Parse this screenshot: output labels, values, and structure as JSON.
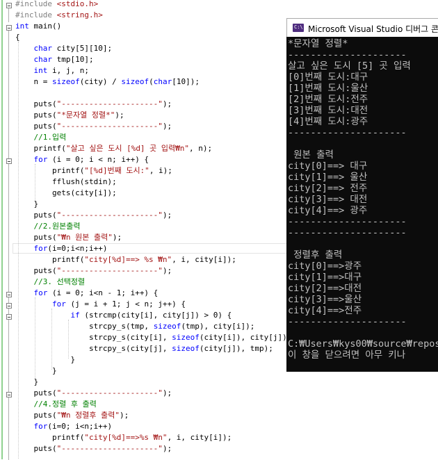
{
  "editor": {
    "lines": [
      [
        [
          "#include ",
          "#808080"
        ],
        [
          "<stdio.h>",
          "#a31515"
        ]
      ],
      [
        [
          "#include ",
          "#808080"
        ],
        [
          "<string.h>",
          "#a31515"
        ]
      ],
      [
        [
          "int ",
          "#0000ff"
        ],
        [
          "main()",
          "#000000"
        ]
      ],
      [
        [
          "{",
          "#000000"
        ]
      ],
      [
        [
          "    char ",
          "#0000ff"
        ],
        [
          "city[5][10];",
          "#000000"
        ]
      ],
      [
        [
          "    char ",
          "#0000ff"
        ],
        [
          "tmp[10];",
          "#000000"
        ]
      ],
      [
        [
          "    int ",
          "#0000ff"
        ],
        [
          "i, j, n;",
          "#000000"
        ]
      ],
      [
        [
          "    n = ",
          "#000000"
        ],
        [
          "sizeof",
          "#0000ff"
        ],
        [
          "(city) / ",
          "#000000"
        ],
        [
          "sizeof",
          "#0000ff"
        ],
        [
          "(",
          "#000000"
        ],
        [
          "char",
          "#0000ff"
        ],
        [
          "[10]);",
          "#000000"
        ]
      ],
      [
        [
          "",
          "#000000"
        ]
      ],
      [
        [
          "    puts(",
          "#000000"
        ],
        [
          "\"---------------------\"",
          "#a31515"
        ],
        [
          ");",
          "#000000"
        ]
      ],
      [
        [
          "    puts(",
          "#000000"
        ],
        [
          "\"*문자열 정렬*\"",
          "#a31515"
        ],
        [
          ");",
          "#000000"
        ]
      ],
      [
        [
          "    puts(",
          "#000000"
        ],
        [
          "\"---------------------\"",
          "#a31515"
        ],
        [
          ");",
          "#000000"
        ]
      ],
      [
        [
          "    //1.입력",
          "#008000"
        ]
      ],
      [
        [
          "    printf(",
          "#000000"
        ],
        [
          "\"살고 싶은 도시 [%d] 곳 입력₩n\"",
          "#a31515"
        ],
        [
          ", n);",
          "#000000"
        ]
      ],
      [
        [
          "    for ",
          "#0000ff"
        ],
        [
          "(i = 0; i < n; i++) {",
          "#000000"
        ]
      ],
      [
        [
          "        printf(",
          "#000000"
        ],
        [
          "\"[%d]번째 도시:\"",
          "#a31515"
        ],
        [
          ", i);",
          "#000000"
        ]
      ],
      [
        [
          "        fflush(stdin);",
          "#000000"
        ]
      ],
      [
        [
          "        gets(city[i]);",
          "#000000"
        ]
      ],
      [
        [
          "    }",
          "#000000"
        ]
      ],
      [
        [
          "    puts(",
          "#000000"
        ],
        [
          "\"---------------------\"",
          "#a31515"
        ],
        [
          ");",
          "#000000"
        ]
      ],
      [
        [
          "    //2.원본출력",
          "#008000"
        ]
      ],
      [
        [
          "    puts(",
          "#000000"
        ],
        [
          "\"₩n 원본 출력\"",
          "#a31515"
        ],
        [
          ");",
          "#000000"
        ]
      ],
      [
        [
          "    for",
          "#0000ff"
        ],
        [
          "(i=0;i<n;i++)",
          "#000000"
        ]
      ],
      [
        [
          "        printf(",
          "#000000"
        ],
        [
          "\"city[%d]==> %s ₩n\"",
          "#a31515"
        ],
        [
          ", i, city[i]);",
          "#000000"
        ]
      ],
      [
        [
          "    puts(",
          "#000000"
        ],
        [
          "\"---------------------\"",
          "#a31515"
        ],
        [
          ");",
          "#000000"
        ]
      ],
      [
        [
          "    //3. 선택정렬",
          "#008000"
        ]
      ],
      [
        [
          "    for ",
          "#0000ff"
        ],
        [
          "(i = 0; i<n - 1; i++) {",
          "#000000"
        ]
      ],
      [
        [
          "        for ",
          "#0000ff"
        ],
        [
          "(j = i + 1; j < n; j++) {",
          "#000000"
        ]
      ],
      [
        [
          "            if ",
          "#0000ff"
        ],
        [
          "(strcmp(city[i], city[j]) > 0) {",
          "#000000"
        ]
      ],
      [
        [
          "                strcpy_s(tmp, ",
          "#000000"
        ],
        [
          "sizeof",
          "#0000ff"
        ],
        [
          "(tmp), city[i]);",
          "#000000"
        ]
      ],
      [
        [
          "                strcpy_s(city[i], ",
          "#000000"
        ],
        [
          "sizeof",
          "#0000ff"
        ],
        [
          "(city[i]), city[j]);",
          "#000000"
        ]
      ],
      [
        [
          "                strcpy_s(city[j], ",
          "#000000"
        ],
        [
          "sizeof",
          "#0000ff"
        ],
        [
          "(city[j]), tmp);",
          "#000000"
        ]
      ],
      [
        [
          "            }",
          "#000000"
        ]
      ],
      [
        [
          "        }",
          "#000000"
        ]
      ],
      [
        [
          "    }",
          "#000000"
        ]
      ],
      [
        [
          "    puts(",
          "#000000"
        ],
        [
          "\"---------------------\"",
          "#a31515"
        ],
        [
          ");",
          "#000000"
        ]
      ],
      [
        [
          "    //4.정렬 후 출력",
          "#008000"
        ]
      ],
      [
        [
          "    puts(",
          "#000000"
        ],
        [
          "\"₩n 정렬후 출력\"",
          "#a31515"
        ],
        [
          ");",
          "#000000"
        ]
      ],
      [
        [
          "    for",
          "#0000ff"
        ],
        [
          "(i=0; i<n;i++)",
          "#000000"
        ]
      ],
      [
        [
          "        printf(",
          "#000000"
        ],
        [
          "\"city[%d]==>%s ₩n\"",
          "#a31515"
        ],
        [
          ", i, city[i]);",
          "#000000"
        ]
      ],
      [
        [
          "    puts(",
          "#000000"
        ],
        [
          "\"---------------------\"",
          "#a31515"
        ],
        [
          ");",
          "#000000"
        ]
      ]
    ]
  },
  "console": {
    "title": "Microsoft Visual Studio 디버그 콘솔",
    "lines": [
      "*문자열 정렬*",
      "---------------------",
      "살고 싶은 도시 [5] 곳 입력",
      "[0]번째 도시:대구",
      "[1]번째 도시:울산",
      "[2]번째 도시:전주",
      "[3]번째 도시:대전",
      "[4]번째 도시:광주",
      "---------------------",
      "",
      " 원본 출력",
      "city[0]==> 대구",
      "city[1]==> 울산",
      "city[2]==> 전주",
      "city[3]==> 대전",
      "city[4]==> 광주",
      "---------------------",
      "---------------------",
      "",
      " 정렬후 출력",
      "city[0]==>광주",
      "city[1]==>대구",
      "city[2]==>대전",
      "city[3]==>울산",
      "city[4]==>전주",
      "---------------------",
      "",
      "C:₩Users₩kys00₩source₩repos",
      "이 창을 닫으려면 아무 키나"
    ]
  }
}
